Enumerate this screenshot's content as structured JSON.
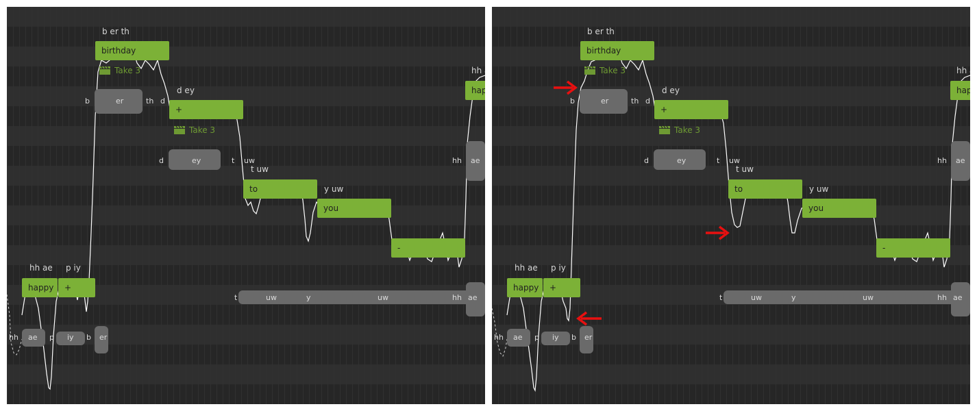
{
  "colors": {
    "background": "#2a2a2a",
    "note_fill": "#7cb137",
    "take_label": "#6e9a33",
    "pitch_curve": "#ffffff",
    "waveform": "#6a6a6a",
    "annotation_arrow": "#e81010"
  },
  "notes": {
    "happy": "happy",
    "happy_plus": "+",
    "birthday": "birthday",
    "dey_plus": "+",
    "to": "to",
    "you": "you",
    "dash": "-",
    "hap": "hap"
  },
  "phonemes": {
    "hh_ae": "hh ae",
    "p_iy": "p iy",
    "b_er_th": "b er th",
    "d_ey": "d ey",
    "t_uw": "t uw",
    "y_uw": "y uw",
    "hh_a": "hh a"
  },
  "takes": {
    "birthday_take": "Take 3",
    "dey_take": "Take 3"
  },
  "waveform_labels": {
    "row1": [
      "b",
      "er",
      "th",
      "d"
    ],
    "row2": [
      "d",
      "ey",
      "t",
      "uw",
      "hh",
      "ae"
    ],
    "row3": [
      "t",
      "uw",
      "y",
      "uw",
      "hh",
      "ae"
    ],
    "row4": [
      "hh",
      "ae",
      "p",
      "iy",
      "b",
      "er"
    ]
  },
  "icons": {
    "take": "clapperboard-icon",
    "annotation": "red-arrow-icon"
  }
}
